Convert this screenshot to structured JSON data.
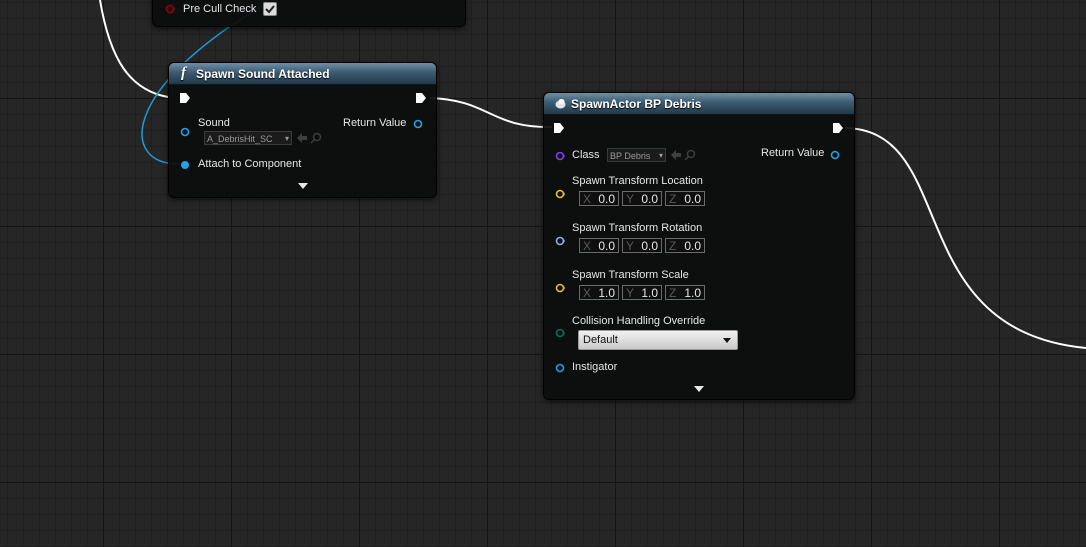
{
  "top_node": {
    "pin_label": "Pre Cull Check",
    "checked": true
  },
  "spawn_sound": {
    "title": "Spawn Sound Attached",
    "func_glyph": "f",
    "sound_label": "Sound",
    "sound_value": "A_DebrisHit_SC",
    "return_label": "Return Value",
    "attach_label": "Attach to Component"
  },
  "spawn_actor": {
    "title": "SpawnActor BP Debris",
    "class_label": "Class",
    "class_value": "BP Debris",
    "return_label": "Return Value",
    "location": {
      "label": "Spawn Transform Location",
      "x": "0.0",
      "y": "0.0",
      "z": "0.0"
    },
    "rotation": {
      "label": "Spawn Transform Rotation",
      "x": "0.0",
      "y": "0.0",
      "z": "0.0"
    },
    "scale": {
      "label": "Spawn Transform Scale",
      "x": "1.0",
      "y": "1.0",
      "z": "1.0"
    },
    "collision": {
      "label": "Collision Handling Override",
      "value": "Default"
    },
    "instigator_label": "Instigator"
  },
  "axis_labels": {
    "x": "X",
    "y": "Y",
    "z": "Z"
  },
  "colors": {
    "exec_wire": "#ffffff",
    "object_wire": "#1e9ad6",
    "object_pin": "#1ea3e6",
    "class_pin": "#7c3ff0",
    "vector_pin": "#e8c12a",
    "rotator_pin": "#9aa7f0",
    "enum_pin": "#0c6e5c",
    "bool_pin": "#9b0000"
  }
}
